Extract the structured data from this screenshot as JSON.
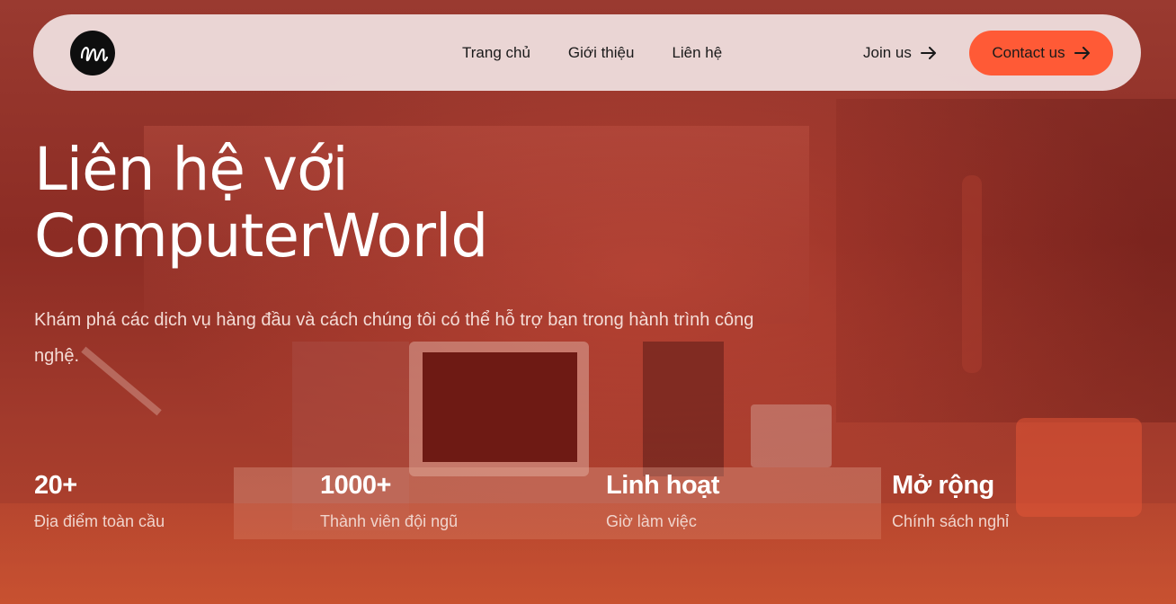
{
  "nav": {
    "logo_icon": "handwritten-m-logo",
    "links": [
      "Trang chủ",
      "Giới thiệu",
      "Liên hệ"
    ],
    "join_label": "Join us",
    "contact_label": "Contact us",
    "accent_color": "#ff5a36"
  },
  "hero": {
    "title_line1": "Liên hệ với",
    "title_line2": "ComputerWorld",
    "subtitle": "Khám phá các dịch vụ hàng đầu và cách chúng tôi có thể hỗ trợ bạn trong hành trình công nghệ."
  },
  "stats": [
    {
      "value": "20+",
      "label": "Địa điểm toàn cầu"
    },
    {
      "value": "1000+",
      "label": "Thành viên đội ngũ"
    },
    {
      "value": "Linh hoạt",
      "label": "Giờ làm việc"
    },
    {
      "value": "Mở rộng",
      "label": "Chính sách nghỉ"
    }
  ]
}
